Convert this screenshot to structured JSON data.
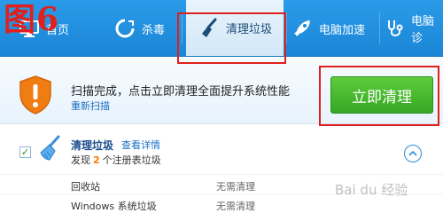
{
  "figure_label": "图6",
  "nav": {
    "home_label": "首页",
    "kill_label": "杀毒",
    "clean_label": "清理垃圾",
    "speed_label": "电脑加速",
    "diag_label": "电脑诊"
  },
  "banner": {
    "scan_status": "扫描完成，点击立即清理全面提升系统性能",
    "rescan_link": "重新扫描",
    "clean_button": "立即清理"
  },
  "category": {
    "title": "清理垃圾",
    "detail_link": "查看详情",
    "found_prefix": "发现",
    "found_count": "2",
    "found_suffix": "个注册表垃圾",
    "checked": true
  },
  "items": [
    {
      "name": "回收站",
      "status": "无需清理"
    },
    {
      "name": "Windows 系统垃圾",
      "status": "无需清理"
    }
  ],
  "watermark": "Bai du 经验",
  "colors": {
    "nav_bg": "#1b86d6",
    "active_tab": "#d2e7f6",
    "clean_button": "#35a823",
    "annotation": "#e0201c",
    "warning": "#f07d12",
    "count_highlight": "#ff7a00"
  },
  "icons": {
    "home": "monitor-icon",
    "kill": "antivirus-icon",
    "clean": "broom-icon",
    "speed": "rocket-icon",
    "diag": "stethoscope-icon",
    "warning": "warning-shield-icon",
    "category": "broom-icon",
    "collapse": "chevron-up-icon"
  }
}
